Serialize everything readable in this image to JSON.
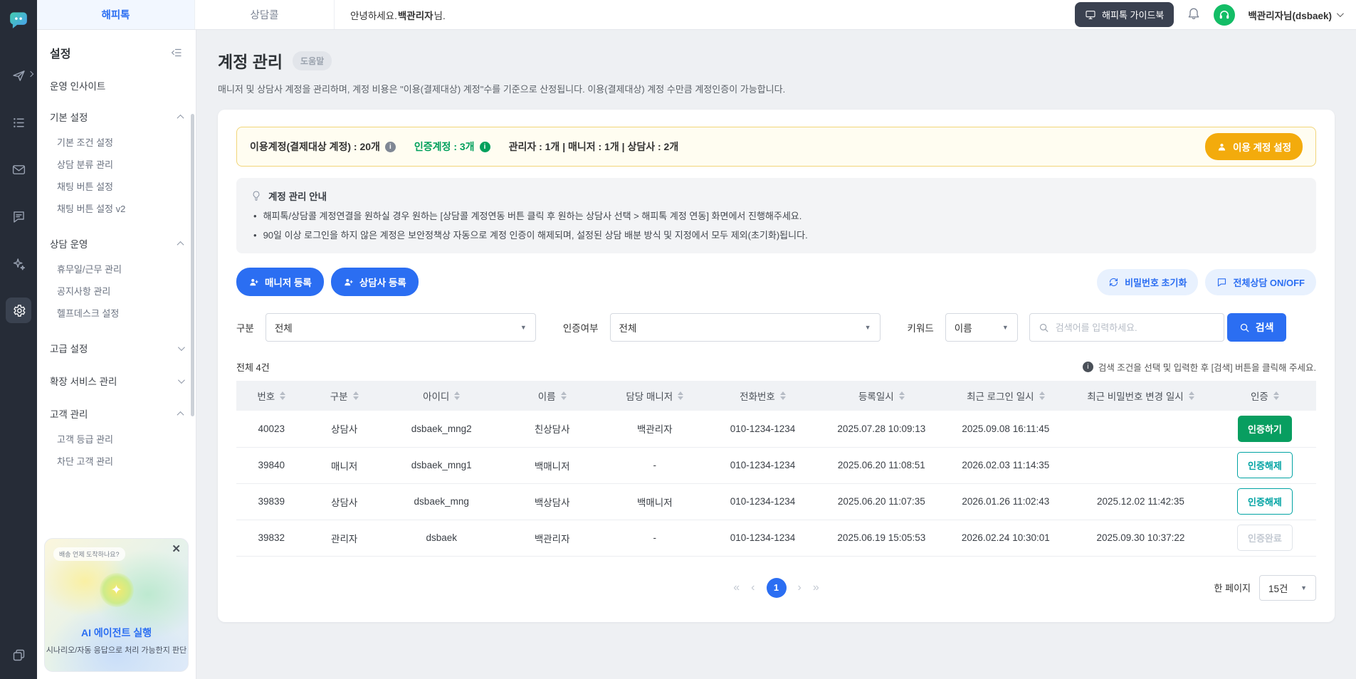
{
  "colors": {
    "accent_blue": "#2b6ef2",
    "green": "#00a05c",
    "teal": "#00a3a3",
    "amber": "#f3ab0c",
    "rail_bg": "#262c37"
  },
  "icons": [
    "happytalk-logo",
    "send-icon",
    "list-icon",
    "mail-icon",
    "chat-icon",
    "sparkles-icon",
    "gear-icon",
    "windows-icon",
    "monitor-icon",
    "bell-icon",
    "headset-icon",
    "person-icon",
    "person-plus-icon",
    "refresh-icon",
    "chat-bubble-icon",
    "search-icon",
    "lightbulb-icon",
    "info-icon",
    "close-icon",
    "chevron-icons"
  ],
  "topbar": {
    "tabs": [
      {
        "label": "해피톡"
      },
      {
        "label": "상담콜"
      }
    ],
    "greeting_prefix": "안녕하세요.",
    "greeting_name": "백관리자",
    "greeting_suffix": " 님.",
    "guidebook_button": "해피톡 가이드북",
    "user_label": "백관리자님(dsbaek)"
  },
  "sidebar": {
    "title": "설정",
    "items": [
      {
        "label": "운영 인사이트"
      },
      {
        "label": "기본 설정",
        "children": [
          "기본 조건 설정",
          "상담 분류 관리",
          "채팅 버튼 설정",
          "채팅 버튼 설정 v2"
        ]
      },
      {
        "label": "상담 운영",
        "children": [
          "휴무일/근무 관리",
          "공지사항 관리",
          "헬프데스크 설정"
        ]
      },
      {
        "label": "고급 설정"
      },
      {
        "label": "확장 서비스 관리"
      },
      {
        "label": "고객 관리",
        "children": [
          "고객 등급 관리",
          "차단 고객 관리"
        ]
      }
    ],
    "promo": {
      "bubble": "배송 언제 도착하나요?",
      "sparkle": "✦",
      "close": "✕",
      "title": "AI 에이전트 실행",
      "subtitle": "시나리오/자동 응답으로 처리 가능한지 판단"
    }
  },
  "page": {
    "title": "계정 관리",
    "help_badge": "도움말",
    "description": "매니저 및 상담사 계정을 관리하며, 계정 비용은 \"이용(결제대상) 계정\"수를 기준으로 산정됩니다. 이용(결제대상) 계정 수만큼 계정인증이 가능합니다."
  },
  "summary": {
    "usage_label": "이용계정(결제대상 계정) : 20개",
    "verified_label": "인증계정 : 3개",
    "breakdown": "관리자 : 1개 | 매니저 : 1개 | 상담사 : 2개",
    "settings_button": "이용 계정 설정"
  },
  "notice": {
    "title": "계정 관리 안내",
    "items": [
      "해피톡/상담콜 계정연결을 원하실 경우 원하는 [상담콜 계정연동 버튼 클릭 후 원하는 상담사 선택 > 해피톡 계정 연동] 화면에서 진행해주세요.",
      "90일 이상 로그인을 하지 않은 계정은 보안정책상 자동으로 계정 인증이 해제되며, 설정된 상담 배분 방식 및 지정에서 모두 제외(초기화)됩니다."
    ]
  },
  "actions": {
    "register_manager": "매니저 등록",
    "register_agent": "상담사 등록",
    "reset_password": "비밀번호 초기화",
    "toggle_all": "전체상담 ON/OFF"
  },
  "filters": {
    "category_label": "구분",
    "category_value": "전체",
    "verify_label": "인증여부",
    "verify_value": "전체",
    "keyword_label": "키워드",
    "keyword_value": "이름",
    "search_placeholder": "검색어를 입력하세요.",
    "search_button": "검색"
  },
  "table": {
    "total": "전체 4건",
    "hint": "검색 조건을 선택 및 입력한 후 [검색] 버튼을 클릭해 주세요.",
    "columns": [
      "번호",
      "구분",
      "아이디",
      "이름",
      "담당 매니저",
      "전화번호",
      "등록일시",
      "최근 로그인 일시",
      "최근 비밀번호 변경 일시",
      "인증"
    ],
    "rows": [
      {
        "no": "40023",
        "type": "상담사",
        "id": "dsbaek_mng2",
        "name": "친상담사",
        "manager": "백관리자",
        "phone": "010-1234-1234",
        "registered": "2025.07.28 10:09:13",
        "last_login": "2025.09.08 16:11:45",
        "pw_changed": "",
        "auth": "인증하기"
      },
      {
        "no": "39840",
        "type": "매니저",
        "id": "dsbaek_mng1",
        "name": "백매니저",
        "manager": "-",
        "phone": "010-1234-1234",
        "registered": "2025.06.20 11:08:51",
        "last_login": "2026.02.03 11:14:35",
        "pw_changed": "",
        "auth": "인증해제"
      },
      {
        "no": "39839",
        "type": "상담사",
        "id": "dsbaek_mng",
        "name": "백상담사",
        "manager": "백매니저",
        "phone": "010-1234-1234",
        "registered": "2025.06.20 11:07:35",
        "last_login": "2026.01.26 11:02:43",
        "pw_changed": "2025.12.02 11:42:35",
        "auth": "인증해제"
      },
      {
        "no": "39832",
        "type": "관리자",
        "id": "dsbaek",
        "name": "백관리자",
        "manager": "-",
        "phone": "010-1234-1234",
        "registered": "2025.06.19 15:05:53",
        "last_login": "2026.02.24 10:30:01",
        "pw_changed": "2025.09.30 10:37:22",
        "auth": "인증완료"
      }
    ],
    "pagination": {
      "first": "«",
      "prev": "‹",
      "current": "1",
      "next": "›",
      "last": "»"
    },
    "per_page_label": "한 페이지",
    "per_page_value": "15건"
  }
}
